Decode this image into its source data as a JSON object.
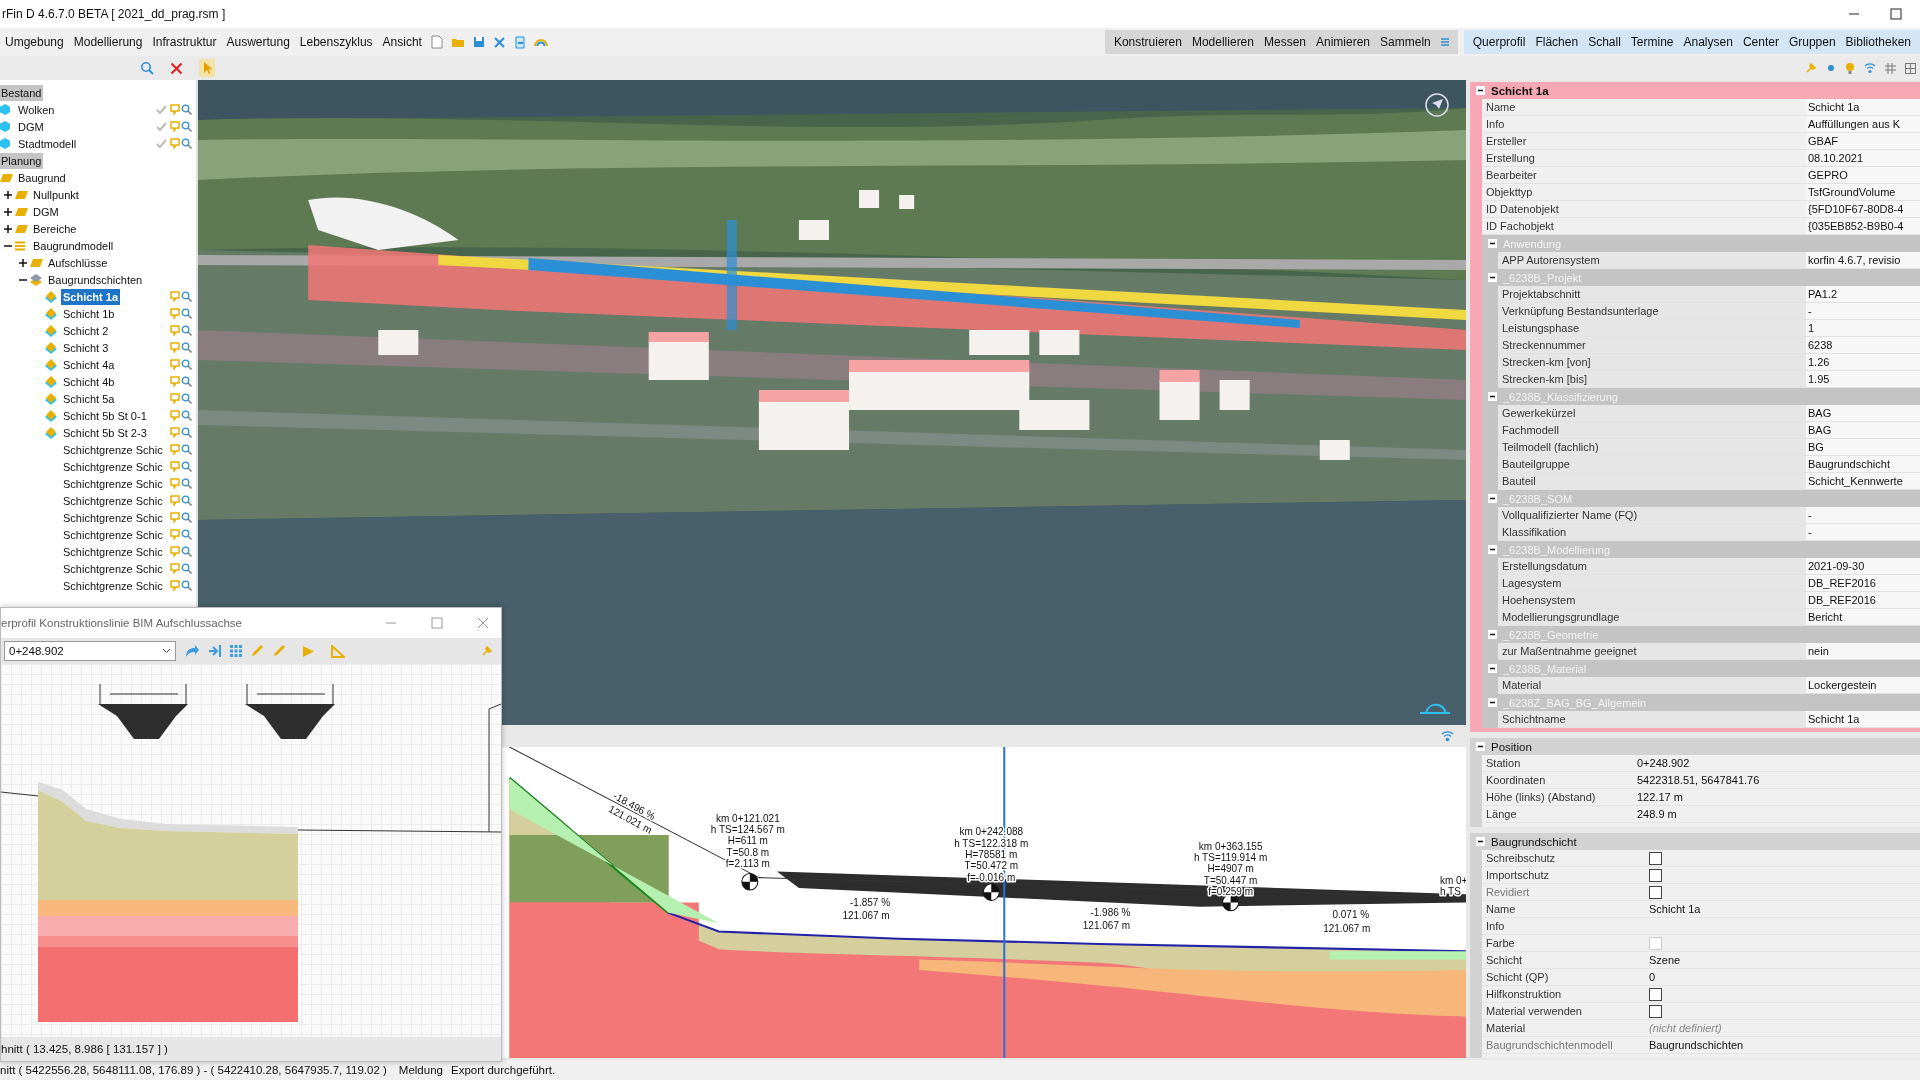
{
  "window": {
    "title": "rFin D 4.6.7.0 BETA [ 2021_dd_prag.rsm ]"
  },
  "menu": [
    "Umgebung",
    "Modellierung",
    "Infrastruktur",
    "Auswertung",
    "Lebenszyklus",
    "Ansicht"
  ],
  "tool_menu": [
    "Konstruieren",
    "Modellieren",
    "Messen",
    "Animieren",
    "Sammeln"
  ],
  "view_menu": [
    "Querprofil",
    "Flächen",
    "Schall",
    "Termine",
    "Analysen",
    "Center",
    "Gruppen",
    "Bibliotheken"
  ],
  "tree": [
    {
      "label": "Bestand",
      "kind": "group",
      "selected": false,
      "children": [
        {
          "label": "Wolken",
          "kind": "cube",
          "selected": false,
          "checked": true,
          "actions": true
        },
        {
          "label": "DGM",
          "kind": "cube",
          "selected": false,
          "checked": true,
          "actions": true
        },
        {
          "label": "Stadtmodell",
          "kind": "cube",
          "selected": false,
          "checked": true,
          "actions": true
        }
      ]
    },
    {
      "label": "Planung",
      "kind": "group",
      "selected": false,
      "children": [
        {
          "label": "Baugrund",
          "kind": "folder",
          "selected": false,
          "children": [
            {
              "label": "Nullpunkt",
              "kind": "folder",
              "expanded": false,
              "selected": false
            },
            {
              "label": "DGM",
              "kind": "folder",
              "expanded": false,
              "selected": false
            },
            {
              "label": "Bereiche",
              "kind": "folder",
              "expanded": false,
              "selected": false
            },
            {
              "label": "Baugrundmodell",
              "kind": "list",
              "expanded": true,
              "selected": false,
              "children": [
                {
                  "label": "Aufschlüsse",
                  "kind": "folder",
                  "expanded": false,
                  "selected": false
                },
                {
                  "label": "Baugrundschichten",
                  "kind": "layers",
                  "expanded": true,
                  "selected": false,
                  "children": [
                    {
                      "label": "Schicht 1a",
                      "kind": "layer",
                      "selected": true,
                      "actions": true
                    },
                    {
                      "label": "Schicht 1b",
                      "kind": "layer",
                      "selected": false,
                      "actions": true
                    },
                    {
                      "label": "Schicht 2",
                      "kind": "layer",
                      "selected": false,
                      "actions": true
                    },
                    {
                      "label": "Schicht 3",
                      "kind": "layer",
                      "selected": false,
                      "actions": true
                    },
                    {
                      "label": "Schicht 4a",
                      "kind": "layer",
                      "selected": false,
                      "actions": true
                    },
                    {
                      "label": "Schicht 4b",
                      "kind": "layer",
                      "selected": false,
                      "actions": true
                    },
                    {
                      "label": "Schicht 5a",
                      "kind": "layer",
                      "selected": false,
                      "actions": true
                    },
                    {
                      "label": "Schicht 5b St 0-1",
                      "kind": "layer",
                      "selected": false,
                      "actions": true
                    },
                    {
                      "label": "Schicht 5b St 2-3",
                      "kind": "layer",
                      "selected": false,
                      "actions": true
                    },
                    {
                      "label": "Schichtgrenze Schic",
                      "kind": "boundary",
                      "selected": false,
                      "actions": true
                    },
                    {
                      "label": "Schichtgrenze Schic",
                      "kind": "boundary",
                      "selected": false,
                      "actions": true
                    },
                    {
                      "label": "Schichtgrenze Schic",
                      "kind": "boundary",
                      "selected": false,
                      "actions": true
                    },
                    {
                      "label": "Schichtgrenze Schic",
                      "kind": "boundary",
                      "selected": false,
                      "actions": true
                    },
                    {
                      "label": "Schichtgrenze Schic",
                      "kind": "boundary",
                      "selected": false,
                      "actions": true
                    },
                    {
                      "label": "Schichtgrenze Schic",
                      "kind": "boundary",
                      "selected": false,
                      "actions": true
                    },
                    {
                      "label": "Schichtgrenze Schic",
                      "kind": "boundary",
                      "selected": false,
                      "actions": true
                    },
                    {
                      "label": "Schichtgrenze Schic",
                      "kind": "boundary",
                      "selected": false,
                      "actions": true
                    },
                    {
                      "label": "Schichtgrenze Schic",
                      "kind": "boundary",
                      "selected": false,
                      "actions": true
                    }
                  ]
                }
              ]
            }
          ]
        }
      ]
    }
  ],
  "properties": {
    "sections": [
      {
        "kind": "object",
        "title": "Schicht 1a",
        "rows": [
          {
            "label": "Name",
            "value": "Schicht 1a"
          },
          {
            "label": "Info",
            "value": "Auffüllungen aus K"
          },
          {
            "label": "Ersteller",
            "value": "GBAF"
          },
          {
            "label": "Erstellung",
            "value": "08.10.2021"
          },
          {
            "label": "Bearbeiter",
            "value": "GEPRO"
          },
          {
            "label": "Objekttyp",
            "value": "TsfGroundVolume"
          },
          {
            "label": "ID Datenobjekt",
            "value": "{5FD10F67-80D8-4"
          },
          {
            "label": "ID Fachobjekt",
            "value": "{035EB852-B9B0-4"
          }
        ],
        "groups": [
          {
            "title": "Anwendung",
            "rows": [
              {
                "label": "APP Autorensystem",
                "value": "korfin 4.6.7, revisio"
              }
            ]
          },
          {
            "title": "_6238B_Projekt",
            "rows": [
              {
                "label": "Projektabschnitt",
                "value": "PA1.2"
              },
              {
                "label": "Verknüpfung Bestandsunterlage",
                "value": "-"
              },
              {
                "label": "Leistungsphase",
                "value": "1"
              },
              {
                "label": "Streckennummer",
                "value": "6238"
              },
              {
                "label": "Strecken-km [von]",
                "value": "1.26"
              },
              {
                "label": "Strecken-km [bis]",
                "value": "1.95"
              }
            ]
          },
          {
            "title": "_6238B_Klassifizierung",
            "rows": [
              {
                "label": "Gewerkekürzel",
                "value": "BAG"
              },
              {
                "label": "Fachmodell",
                "value": "BAG"
              },
              {
                "label": "Teilmodell (fachlich)",
                "value": "BG"
              },
              {
                "label": "Bauteilgruppe",
                "value": "Baugrundschicht"
              },
              {
                "label": "Bauteil",
                "value": "Schicht_Kennwerte"
              }
            ]
          },
          {
            "title": "_6238B_SOM",
            "rows": [
              {
                "label": "Vollqualifizierter Name (FQ)",
                "value": "-"
              },
              {
                "label": "Klassifikation",
                "value": "-"
              }
            ]
          },
          {
            "title": "_6238B_Modellierung",
            "rows": [
              {
                "label": "Erstellungsdatum",
                "value": "2021-09-30"
              },
              {
                "label": "Lagesystem",
                "value": "DB_REF2016"
              },
              {
                "label": "Hoehensystem",
                "value": "DB_REF2016"
              },
              {
                "label": "Modellierungsgrundlage",
                "value": "Bericht"
              }
            ]
          },
          {
            "title": "_6238B_Geometrie",
            "rows": [
              {
                "label": "zur Maßentnahme geeignet",
                "value": "nein"
              }
            ]
          },
          {
            "title": "_6238B_Material",
            "rows": [
              {
                "label": "Material",
                "value": "Lockergestein"
              }
            ]
          },
          {
            "title": "_6238Z_BAG_BG_Allgemein",
            "rows": [
              {
                "label": "Schichtname",
                "value": "Schicht 1a"
              }
            ]
          }
        ]
      },
      {
        "kind": "plain",
        "title": "Position",
        "rows": [
          {
            "label": "Station",
            "value": "0+248.902"
          },
          {
            "label": "Koordinaten",
            "value": "5422318.51, 5647841.76"
          },
          {
            "label": "Höhe (links) (Abstand)",
            "value": "122.17 m"
          },
          {
            "label": "Länge",
            "value": "248.9 m"
          }
        ]
      },
      {
        "kind": "plain",
        "title": "Baugrundschicht",
        "rows": [
          {
            "label": "Schreibschutz",
            "kind": "checkbox",
            "checked": false,
            "disabled": false
          },
          {
            "label": "Importschutz",
            "kind": "checkbox",
            "checked": false,
            "disabled": false
          },
          {
            "label": "Revidiert",
            "kind": "checkbox",
            "checked": false,
            "disabled": true
          },
          {
            "label": "Name",
            "kind": "text",
            "value": "Schicht 1a",
            "disabled": false
          },
          {
            "label": "Info",
            "kind": "text",
            "disabled": false
          },
          {
            "label": "Farbe",
            "kind": "color",
            "color": "#ffffff",
            "disabled": false
          },
          {
            "label": "Schicht",
            "kind": "text",
            "value": "Szene",
            "disabled": false
          },
          {
            "label": "Schicht (QP)",
            "kind": "text",
            "value": "0",
            "disabled": false
          },
          {
            "label": "Hilfkonstruktion",
            "kind": "checkbox",
            "checked": false,
            "disabled": false
          },
          {
            "label": "Material verwenden",
            "kind": "checkbox",
            "checked": false,
            "disabled": false
          },
          {
            "label": "Material",
            "kind": "hint",
            "value": "(nicht definiert)",
            "disabled": false
          },
          {
            "label": "Baugrundschichtenmodell",
            "kind": "text",
            "value": "Baugrundschichten",
            "disabled": true
          }
        ]
      }
    ]
  },
  "profile_view": {
    "stations": [
      {
        "km": "km 0+121.021",
        "hts": "h TS=124.567 m",
        "h": "H=611 m",
        "t": "T=50.8 m",
        "f": "f=2.113 m"
      },
      {
        "km": "km 0+242.088",
        "hts": "h TS=122.318 m",
        "h": "H=78581 m",
        "t": "T=50.472 m",
        "f": "f=-0.016 m"
      },
      {
        "km": "km 0+363.155",
        "hts": "h TS=119.914 m",
        "h": "H=4907 m",
        "t": "T=50.447 m",
        "f": "f=0.259 m"
      }
    ],
    "gradients": [
      {
        "percent": "-18.496 %",
        "length": "121.021 m"
      },
      {
        "percent": "-1.857 %",
        "length": "121.067 m"
      },
      {
        "percent": "-1.986 %",
        "length": "121.067 m"
      },
      {
        "percent": "0.071 %",
        "length": "121.067 m"
      }
    ],
    "cut_labels": [
      "km 0+",
      "h TS"
    ]
  },
  "cross_section_window": {
    "title": "erprofil Konstruktionslinie BIM Aufschlussachse",
    "station": "0+248.902",
    "status": "hnitt  ( 13.425, 8.986 [ 131.157 ] )"
  },
  "status_bar": {
    "coordinates": "nitt  ( 5422556.28, 5648111.08, 176.89 ) - ( 5422410.28, 5647935.7, 119.02 )",
    "message_label": "Meldung",
    "message": "Export durchgeführt."
  }
}
